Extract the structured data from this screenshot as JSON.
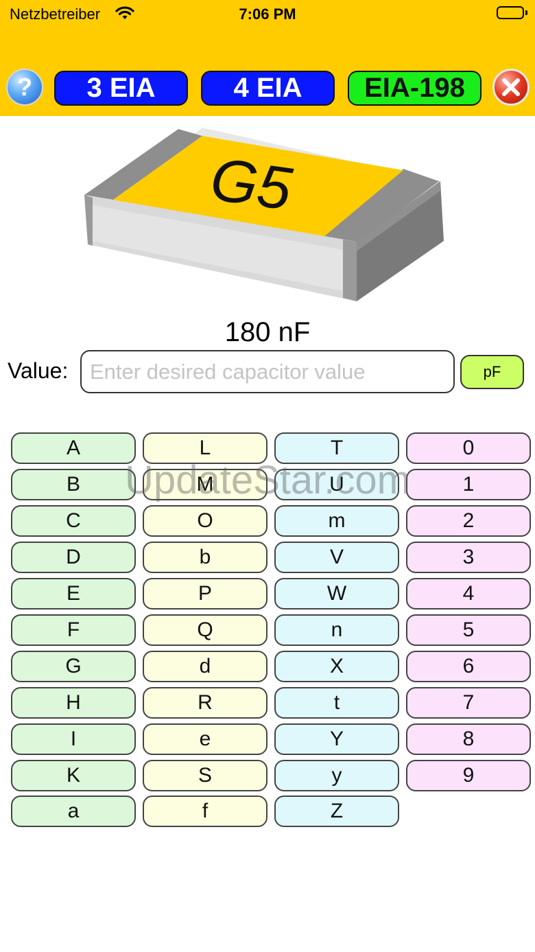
{
  "status": {
    "carrier": "Netzbetreiber",
    "time": "7:06 PM"
  },
  "toolbar": {
    "help_label": "?",
    "mode_3eia": "3 EIA",
    "mode_4eia": "4 EIA",
    "mode_eia198": "EIA-198"
  },
  "chip": {
    "code": "G5"
  },
  "result": "180 nF",
  "value": {
    "label": "Value:",
    "placeholder": "Enter desired capacitor value",
    "current": "",
    "unit": "pF"
  },
  "keypad": {
    "col1": [
      "A",
      "B",
      "C",
      "D",
      "E",
      "F",
      "G",
      "H",
      "I",
      "K",
      "a"
    ],
    "col2": [
      "L",
      "M",
      "O",
      "b",
      "P",
      "Q",
      "d",
      "R",
      "e",
      "S",
      "f"
    ],
    "col3": [
      "T",
      "U",
      "m",
      "V",
      "W",
      "n",
      "X",
      "t",
      "Y",
      "y",
      "Z"
    ],
    "col4": [
      "0",
      "1",
      "2",
      "3",
      "4",
      "5",
      "6",
      "7",
      "8",
      "9"
    ]
  },
  "watermark": "UpdateStar.com",
  "colors": {
    "header": "#ffcc00",
    "mode_blue": "#0a18ff",
    "mode_green": "#1aee1a",
    "unit_button": "#ccff66",
    "chip_label": "#ffcc00",
    "col1": "#dcf7da",
    "col2": "#fdfde0",
    "col3": "#dff8fb",
    "col4": "#fde2fc"
  }
}
